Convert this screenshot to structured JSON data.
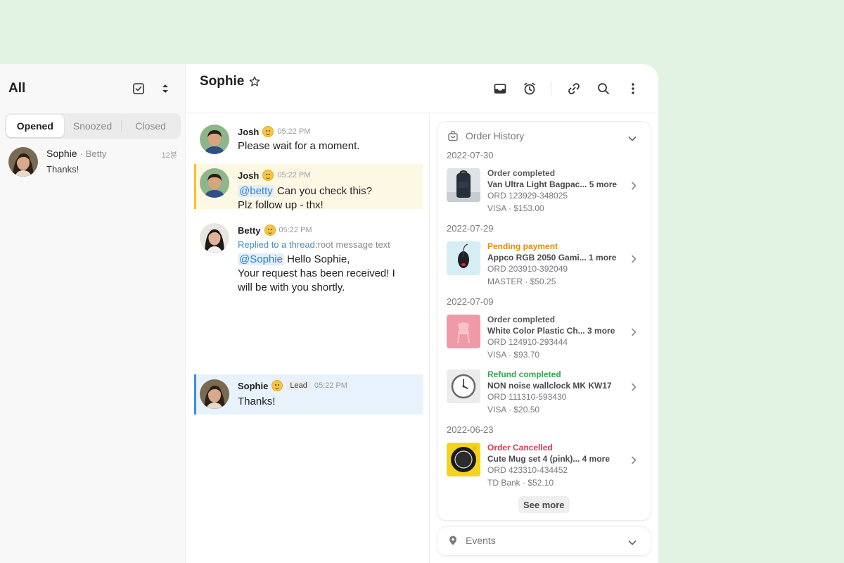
{
  "list": {
    "title": "All",
    "tabs": [
      "Opened",
      "Snoozed",
      "Closed"
    ],
    "active_tab": "Opened",
    "chats": [
      {
        "name": "Sophie",
        "separator": "·",
        "assignee": "Betty",
        "time": "12분",
        "preview": "Thanks!"
      }
    ]
  },
  "conversation": {
    "title": "Sophie",
    "messages": [
      {
        "author": "Josh",
        "time": "05:22 PM",
        "text": "Please wait for a moment."
      },
      {
        "author": "Josh",
        "time": "05:22 PM",
        "mention": "@betty",
        "text_after_mention": "Can you check this?",
        "line2": "Plz follow up - thx!"
      },
      {
        "author": "Betty",
        "time": "05:22 PM",
        "reply_label": "Replied to a thread:",
        "reply_text": "root message text",
        "mention": "@Sophie",
        "text_after_mention": "Hello Sophie,",
        "line2": "Your request has been received! I",
        "line3": "will be with you shortly."
      },
      {
        "author": "Sophie",
        "badge": "Lead",
        "time": "05:22 PM",
        "text": "Thanks!"
      }
    ]
  },
  "order_history": {
    "title": "Order History",
    "groups": [
      {
        "date": "2022-07-30",
        "orders": [
          {
            "status": "Order completed",
            "status_color": "#5a5a5e",
            "name": "Van Ultra Light Bagpac... 5 more",
            "id": "ORD 123929-348025",
            "payment": "VISA · $153.00"
          }
        ]
      },
      {
        "date": "2022-07-29",
        "orders": [
          {
            "status": "Pending payment",
            "status_color": "#e68a00",
            "name": "Appco RGB 2050 Gami... 1 more",
            "id": "ORD 203910-392049",
            "payment": "MASTER · $50.25"
          }
        ]
      },
      {
        "date": "2022-07-09",
        "orders": [
          {
            "status": "Order completed",
            "status_color": "#5a5a5e",
            "name": "White Color Plastic Ch... 3 more",
            "id": "ORD 124910-293444",
            "payment": "VISA · $93.70"
          },
          {
            "status": "Refund completed",
            "status_color": "#2ea84f",
            "name": "NON noise wallclock MK KW17",
            "id": "ORD 111310-593430",
            "payment": "VISA · $20.50"
          }
        ]
      },
      {
        "date": "2022-06-23",
        "orders": [
          {
            "status": "Order Cancelled",
            "status_color": "#e0354f",
            "name": "Cute Mug set 4 (pink)... 4 more",
            "id": "ORD 423310-434452",
            "payment": "TD Bank · $52.10"
          }
        ]
      }
    ],
    "see_more_label": "See more"
  },
  "events": {
    "title": "Events"
  },
  "icons": {
    "list_header": [
      "checkbox-icon",
      "sort-icon"
    ],
    "conversation_header": [
      "star-icon",
      "inbox-icon",
      "alarm-icon",
      "link-icon",
      "search-icon",
      "more-vertical-icon"
    ],
    "order_history": [
      "shopping-bag-icon",
      "chevron-down-icon",
      "chevron-right-icon"
    ],
    "events": [
      "map-pin-icon",
      "chevron-down-icon"
    ]
  },
  "colors": {
    "background": "#e3f3e3",
    "highlight_yellow": "#fdf8e4",
    "highlight_yellow_bar": "#f3c030",
    "highlight_blue": "#e8f2fc",
    "highlight_blue_bar": "#3a8ce2",
    "mention": "#2f7fd0"
  }
}
